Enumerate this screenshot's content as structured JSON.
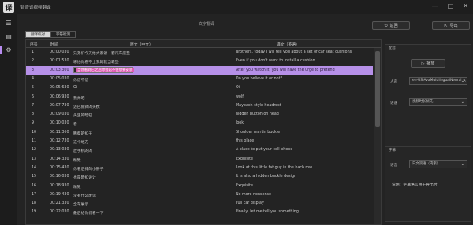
{
  "app": {
    "logo": "译",
    "title": "智音译视频翻译"
  },
  "window": {
    "min": "—",
    "max": "□",
    "close": "✕"
  },
  "sidebar": {
    "icons": [
      "menu-icon",
      "document-icon",
      "settings-icon"
    ]
  },
  "header": {
    "section_title": "文字翻译",
    "back_label": "返回",
    "export_label": "导出"
  },
  "tabs": [
    {
      "label": "翻译校对"
    },
    {
      "label": "字符检测"
    }
  ],
  "table": {
    "columns": [
      "序号",
      "时间",
      "原文（中文）",
      "译文（英语）"
    ],
    "rows": [
      {
        "no": "1",
        "time": "00:00.030",
        "src": "兄弟们今天给大家讲一套汽车座垫",
        "dst": "Brothers, today I will tell you about a set of car seat cushions"
      },
      {
        "no": "2",
        "time": "00:01.530",
        "src": "哪怕你看不上我的就当靠垫",
        "dst": "Even if you don't want to install a cushion"
      },
      {
        "no": "3",
        "time": "00:03.300",
        "src": "当你看到它之后你会忍不住想要安装",
        "dst": "After you watch it, you will have the urge to pretend"
      },
      {
        "no": "4",
        "time": "00:05.030",
        "src": "你信不信",
        "dst": "Do you believe it or not?"
      },
      {
        "no": "5",
        "time": "00:05.630",
        "src": "Oi",
        "dst": "Oi"
      },
      {
        "no": "6",
        "time": "00:06.930",
        "src": "我帅吧",
        "dst": "wolf."
      },
      {
        "no": "7",
        "time": "00:07.730",
        "src": "迈巴赫式的头枕",
        "dst": "Maybach-style headrest"
      },
      {
        "no": "8",
        "time": "00:09.030",
        "src": "头里的暗钮",
        "dst": "hidden button on head"
      },
      {
        "no": "9",
        "time": "00:10.030",
        "src": "看",
        "dst": "look"
      },
      {
        "no": "10",
        "time": "00:11.360",
        "src": "腾蔡的扣子",
        "dst": "Shoulder martin buckle"
      },
      {
        "no": "11",
        "time": "00:12.730",
        "src": "这个地方",
        "dst": "this place"
      },
      {
        "no": "12",
        "time": "00:13.030",
        "src": "放手机的的",
        "dst": "A place to put your cell phone"
      },
      {
        "no": "13",
        "time": "00:14.330",
        "src": "精致",
        "dst": "Exquisite"
      },
      {
        "no": "14",
        "time": "00:15.430",
        "src": "你看后排的小胖子",
        "dst": "Look at this little fat guy in the back row"
      },
      {
        "no": "15",
        "time": "00:16.030",
        "src": "也是暗扣设计",
        "dst": "It is also a hidden buckle design"
      },
      {
        "no": "16",
        "time": "00:18.930",
        "src": "精致",
        "dst": "Exquisite"
      },
      {
        "no": "17",
        "time": "00:19.430",
        "src": "没有什么废话",
        "dst": "No more nonsense"
      },
      {
        "no": "18",
        "time": "00:21.330",
        "src": "全车展示",
        "dst": "Full car display"
      },
      {
        "no": "19",
        "time": "00:22.030",
        "src": "最后给你们看一下",
        "dst": "Finally, let me tell you something"
      }
    ]
  },
  "editing": {
    "text": "当你看到它之后你会忍不住想要安装"
  },
  "panel_voice": {
    "title": "配音",
    "play_label": "播放",
    "voice_label": "人声",
    "voice_value": "en-US-AvaMultilingualNeural 女",
    "speed_label": "语速",
    "speed_value": "视频时长优先"
  },
  "panel_subtitle": {
    "title": "字幕",
    "lang_label": "语言",
    "lang_value": "日文双语（内嵌）",
    "hint": "说明：字幕语言用于导出时"
  }
}
